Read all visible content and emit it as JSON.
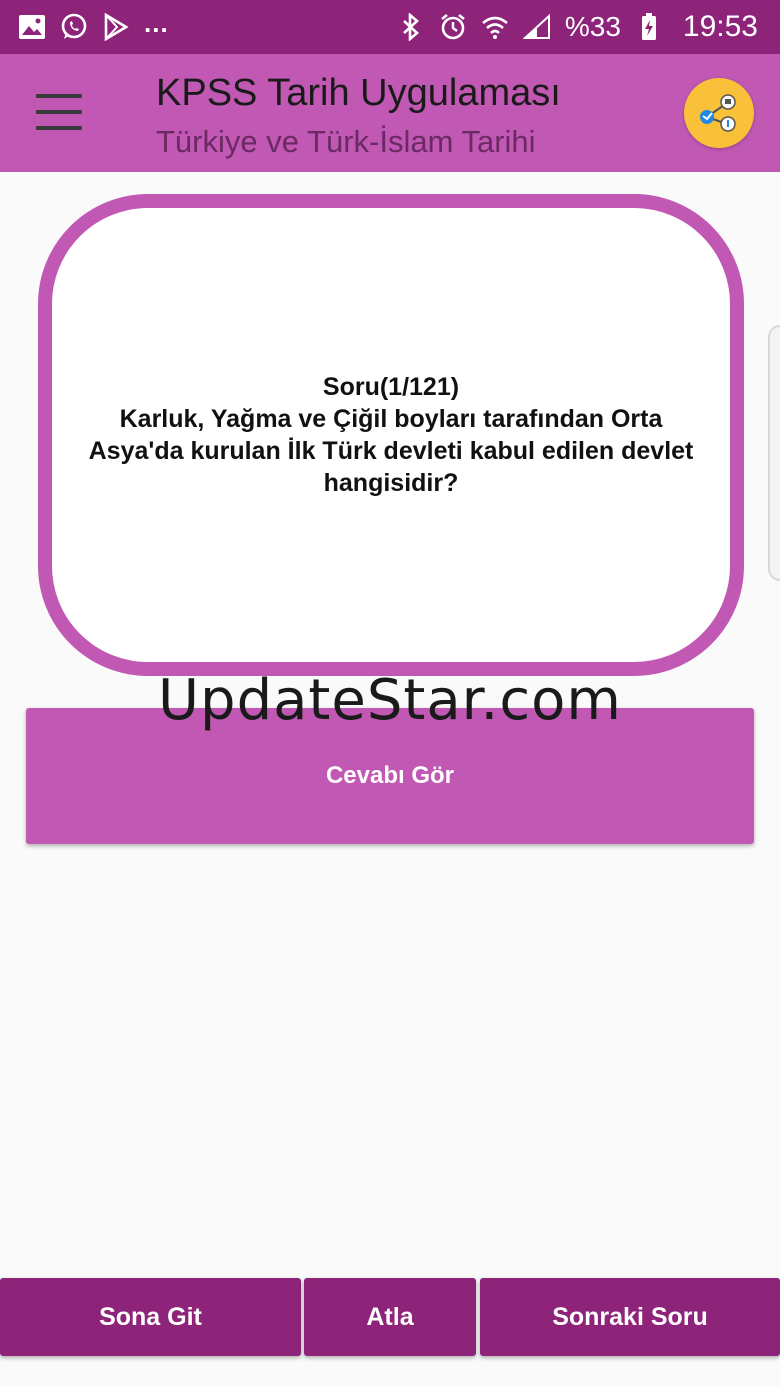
{
  "status_bar": {
    "left_icons": [
      "gallery-icon",
      "whatsapp-icon",
      "play-store-icon"
    ],
    "more": "...",
    "battery": "%33",
    "time": "19:53"
  },
  "app_bar": {
    "title": "KPSS Tarih Uygulaması",
    "subtitle": "Türkiye ve Türk-İslam Tarihi"
  },
  "question": {
    "counter": "Soru(1/121)",
    "text": "Karluk, Yağma ve Çiğil boyları tarafından Orta Asya'da kurulan İlk Türk devleti kabul edilen devlet hangisidir?"
  },
  "watermark": "UpdateStar.com",
  "answer_button": "Cevabı Gör",
  "bottom_nav": {
    "go_last": "Sona Git",
    "skip": "Atla",
    "next": "Sonraki Soru"
  },
  "colors": {
    "status_bar": "#8e237a",
    "app_bar": "#c158b4",
    "accent": "#c158b4",
    "share": "#f9c13a"
  }
}
